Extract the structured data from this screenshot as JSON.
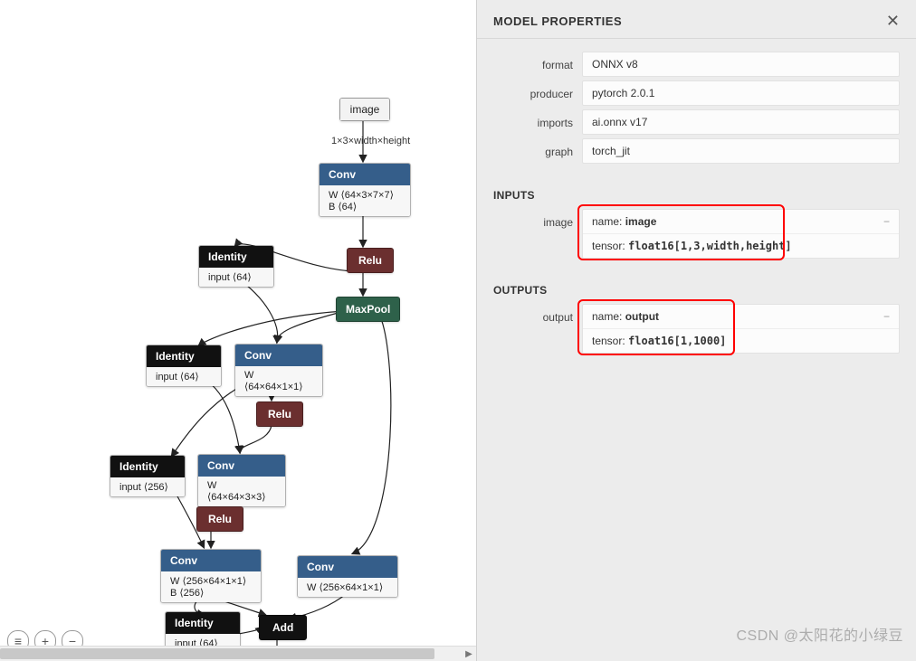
{
  "panel": {
    "title": "MODEL PROPERTIES",
    "sections": {
      "props": [
        {
          "label": "format",
          "value": "ONNX v8"
        },
        {
          "label": "producer",
          "value": "pytorch 2.0.1"
        },
        {
          "label": "imports",
          "value": "ai.onnx v17"
        },
        {
          "label": "graph",
          "value": "torch_jit"
        }
      ],
      "inputs": {
        "heading": "INPUTS",
        "items": [
          {
            "label": "image",
            "name_label": "name:",
            "name_value": "image",
            "tensor_label": "tensor:",
            "tensor_value": "float16[1,3,width,height]",
            "highlighted": true
          }
        ]
      },
      "outputs": {
        "heading": "OUTPUTS",
        "items": [
          {
            "label": "output",
            "name_label": "name:",
            "name_value": "output",
            "tensor_label": "tensor:",
            "tensor_value": "float16[1,1000]",
            "highlighted": true
          }
        ]
      }
    }
  },
  "graph": {
    "input_node": {
      "label": "image",
      "shape_text": "1×3×width×height"
    },
    "nodes": {
      "conv1": {
        "title": "Conv",
        "w": "W ⟨64×3×7×7⟩",
        "b": "B ⟨64⟩"
      },
      "relu1": {
        "title": "Relu"
      },
      "maxpool": {
        "title": "MaxPool"
      },
      "id1": {
        "title": "Identity",
        "detail": "input ⟨64⟩"
      },
      "conv2": {
        "title": "Conv",
        "w": "W ⟨64×64×1×1⟩"
      },
      "relu2": {
        "title": "Relu"
      },
      "id2": {
        "title": "Identity",
        "detail": "input ⟨64⟩"
      },
      "conv3": {
        "title": "Conv",
        "w": "W ⟨64×64×3×3⟩"
      },
      "relu3": {
        "title": "Relu"
      },
      "id3": {
        "title": "Identity",
        "detail": "input ⟨256⟩"
      },
      "conv4": {
        "title": "Conv",
        "w": "W ⟨256×64×1×1⟩",
        "b": "B ⟨256⟩"
      },
      "conv5": {
        "title": "Conv",
        "w": "W ⟨256×64×1×1⟩"
      },
      "add": {
        "title": "Add"
      },
      "id4": {
        "title": "Identity",
        "detail": "input ⟨64⟩"
      }
    }
  },
  "toolbar": {
    "menu": "≡",
    "zoom_in": "+",
    "zoom_out": "−"
  },
  "icons": {
    "close": "✕",
    "dash": "−"
  },
  "watermark": "CSDN @太阳花的小绿豆"
}
